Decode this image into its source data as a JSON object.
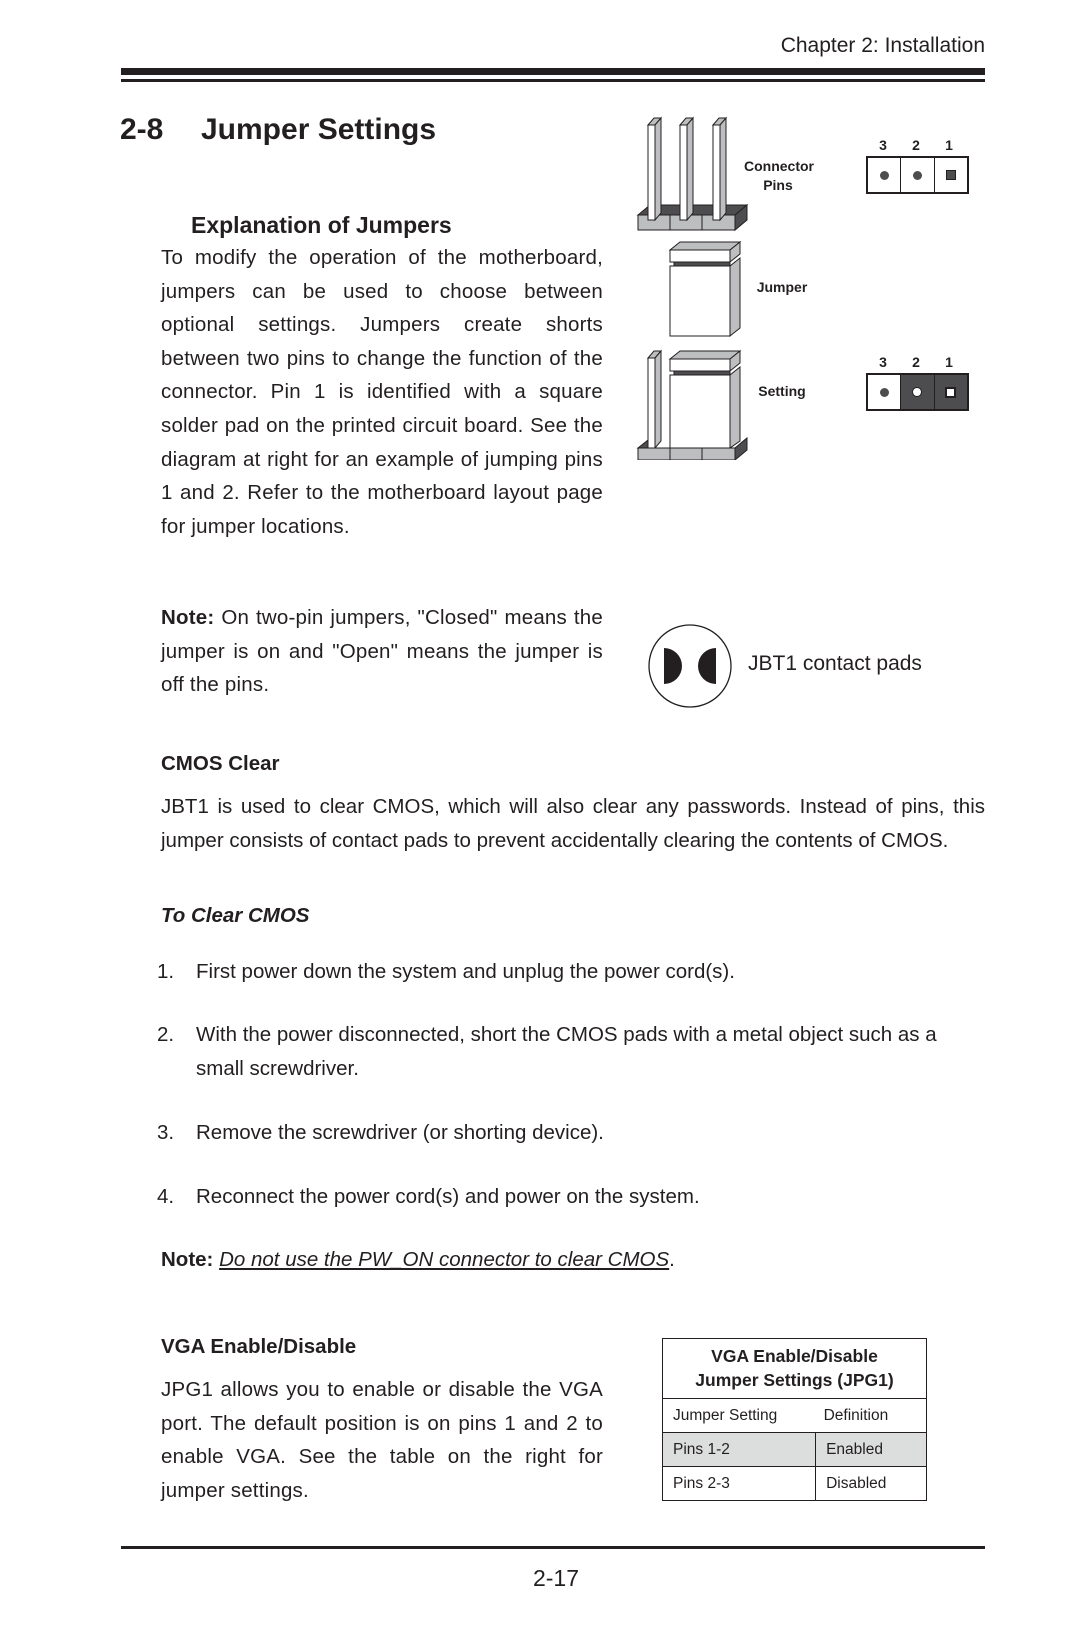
{
  "header": {
    "chapter": "Chapter 2: Installation"
  },
  "title": {
    "number": "2-8",
    "text": "Jumper Settings"
  },
  "explanation": {
    "heading": "Explanation of Jumpers",
    "body": "To modify the operation of the motherboard, jumpers can be used to choose between optional settings. Jumpers create shorts between two pins to change the function of the connector. Pin 1 is identified with a square solder pad on the printed circuit board. See the diagram at right for an example of jumping pins 1 and 2. Refer to the motherboard layout page for jumper locations.",
    "note_label": "Note:",
    "note_text": " On two-pin jumpers, \"Closed\" means the jumper is on and \"Open\" means the jumper is off the pins."
  },
  "diagram": {
    "connector_label_1": "Connector",
    "connector_label_2": "Pins",
    "jumper_label": "Jumper",
    "setting_label": "Setting",
    "pin_numbers": [
      "3",
      "2",
      "1"
    ],
    "connector_pins": [
      {
        "pin": "3",
        "shape": "round",
        "jumpered": false
      },
      {
        "pin": "2",
        "shape": "round",
        "jumpered": false
      },
      {
        "pin": "1",
        "shape": "square",
        "jumpered": false
      }
    ],
    "setting_pins": [
      {
        "pin": "3",
        "shape": "round",
        "jumpered": false
      },
      {
        "pin": "2",
        "shape": "round",
        "jumpered": true
      },
      {
        "pin": "1",
        "shape": "square",
        "jumpered": true
      }
    ],
    "jbt1_label": "JBT1 contact pads"
  },
  "cmos": {
    "heading": "CMOS Clear",
    "body": "JBT1 is used to clear CMOS, which will also clear any passwords. Instead of pins, this jumper consists of contact pads to prevent accidentally clearing the contents of CMOS.",
    "subheading": "To Clear CMOS",
    "steps": [
      {
        "n": "1.",
        "text": "First power down the system and unplug the power cord(s)."
      },
      {
        "n": "2.",
        "text": "With the power disconnected, short the CMOS pads with a metal object such as a small screwdriver."
      },
      {
        "n": "3.",
        "text": "Remove the screwdriver (or shorting device)."
      },
      {
        "n": "4.",
        "text": "Reconnect the power cord(s) and power on the system."
      }
    ],
    "note_label": "Note:",
    "note_text": "Do not use the PW_ON connector to clear CMOS",
    "note_end": "."
  },
  "vga": {
    "heading": "VGA Enable/Disable",
    "body": "JPG1 allows you to enable or disable the VGA port. The default position is on pins 1 and 2 to enable VGA. See the table on the right for jumper settings.",
    "table": {
      "title_line1": "VGA Enable/Disable",
      "title_line2": "Jumper Settings (JPG1)",
      "columns": [
        "Jumper Setting",
        "Definition"
      ],
      "rows": [
        [
          "Pins 1-2",
          "Enabled"
        ],
        [
          "Pins 2-3",
          "Disabled"
        ]
      ]
    }
  },
  "footer": {
    "page_number": "2-17"
  }
}
